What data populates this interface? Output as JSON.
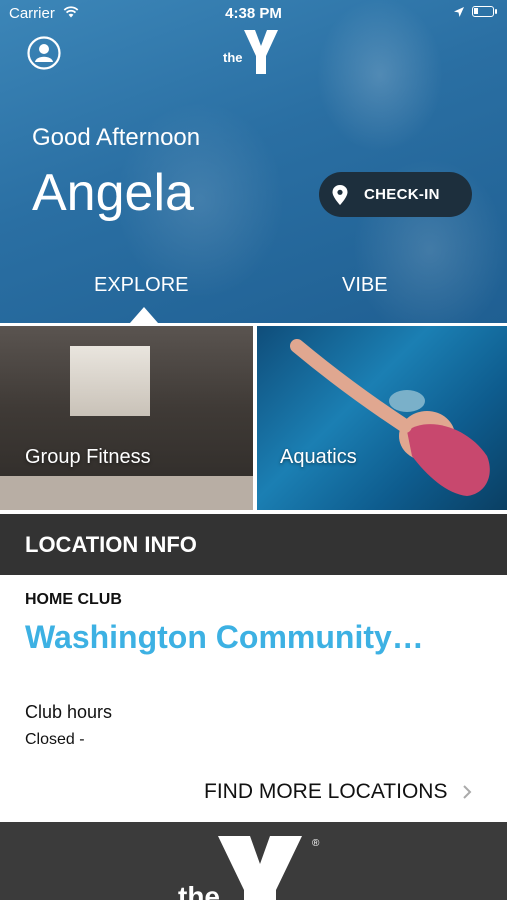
{
  "status_bar": {
    "carrier": "Carrier",
    "time": "4:38 PM"
  },
  "header": {
    "logo_text": "the",
    "greeting": "Good Afternoon",
    "user_name": "Angela",
    "checkin_label": "CHECK-IN"
  },
  "tabs": [
    {
      "label": "EXPLORE",
      "selected": true
    },
    {
      "label": "VIBE",
      "selected": false
    }
  ],
  "tiles": [
    {
      "label": "Group Fitness"
    },
    {
      "label": "Aquatics"
    }
  ],
  "location_info": {
    "section_title": "LOCATION INFO",
    "home_club_label": "HOME CLUB",
    "club_name": "Washington Community…",
    "hours_label": "Club hours",
    "hours_value": "Closed -",
    "find_more_label": "FIND MORE LOCATIONS"
  },
  "footer": {
    "logo_text": "the"
  },
  "colors": {
    "accent_blue": "#3db1e3",
    "hero_blue": "#2a6fa3",
    "checkin_bg": "#1d2f3d",
    "section_bar": "#333333"
  },
  "icons": [
    "wifi-icon",
    "location-arrow-icon",
    "battery-icon",
    "profile-icon",
    "ymca-logo",
    "map-pin-icon",
    "chevron-right-icon"
  ]
}
